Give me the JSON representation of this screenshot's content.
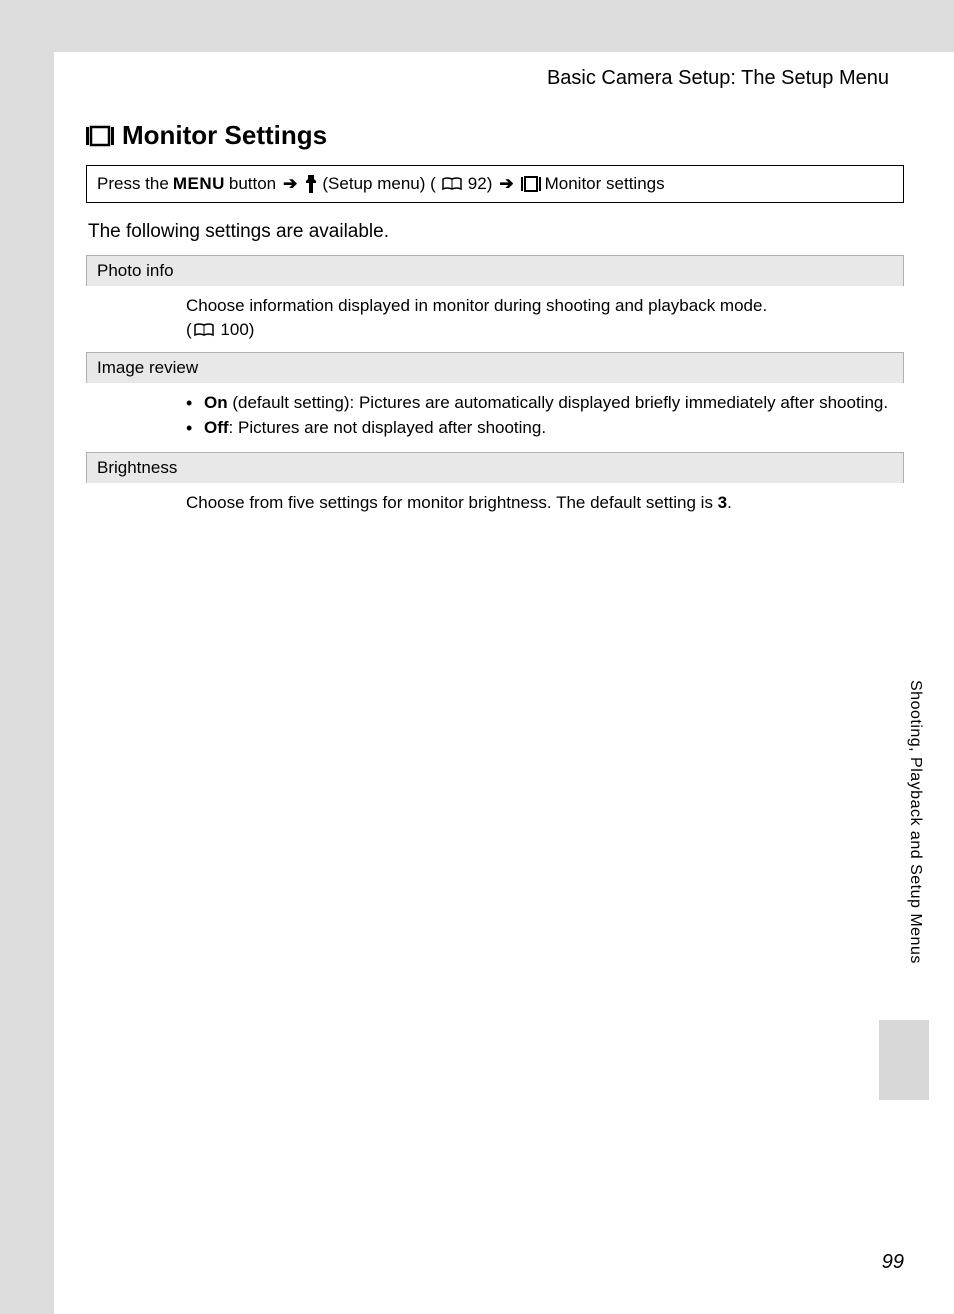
{
  "chapter_header": "Basic Camera Setup: The Setup Menu",
  "section_title": "Monitor Settings",
  "nav_path": {
    "prefix": "Press the",
    "menu_label": "MENU",
    "button_text": "button",
    "setup_menu_text": "(Setup menu) (",
    "page_ref_92": "92)",
    "monitor_settings_text": "Monitor settings"
  },
  "intro": "The following settings are available.",
  "settings": {
    "photo_info": {
      "header": "Photo info",
      "desc_line1": "Choose information displayed in monitor during shooting and playback mode.",
      "desc_line2_prefix": "(",
      "desc_line2_ref": "100)"
    },
    "image_review": {
      "header": "Image review",
      "on_label": "On",
      "on_desc": " (default setting): Pictures are automatically displayed briefly immediately after shooting.",
      "off_label": "Off",
      "off_desc": ": Pictures are not displayed after shooting."
    },
    "brightness": {
      "header": "Brightness",
      "desc_prefix": "Choose from five settings for monitor brightness. The default setting is ",
      "default_value": "3",
      "desc_suffix": "."
    }
  },
  "side_tab": "Shooting, Playback and Setup Menus",
  "page_number": "99"
}
